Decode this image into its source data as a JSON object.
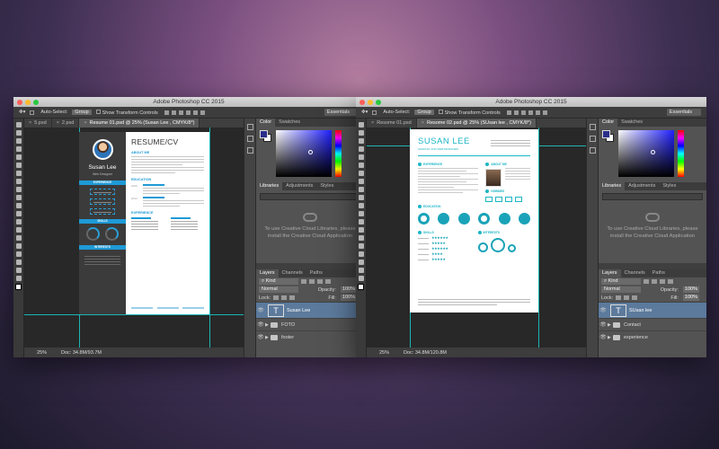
{
  "windows": [
    {
      "title": "Adobe Photoshop CC 2015",
      "options": {
        "auto_select_label": "Auto-Select:",
        "auto_select_value": "Group",
        "transform_label": "Show Transform Controls",
        "workspace": "Essentials"
      },
      "tabs": [
        {
          "label": "5.psd"
        },
        {
          "label": "2.psd"
        },
        {
          "label": "Resume 01.psd @ 25% (Susan Lee , CMYK/8*)"
        }
      ],
      "status": {
        "zoom": "25%",
        "doc": "Doc: 34.8M/93.7M"
      },
      "color_tabs": [
        "Color",
        "Swatches"
      ],
      "lib_tabs": [
        "Libraries",
        "Adjustments",
        "Styles"
      ],
      "libraries_message": "To use Creative Cloud Libraries, please install the Creative Cloud Application",
      "layer_tabs": [
        "Layers",
        "Channels",
        "Paths"
      ],
      "layer_controls": {
        "kind": "Kind",
        "blend": "Normal",
        "opacity_label": "Opacity:",
        "opacity": "100%",
        "lock_label": "Lock:",
        "fill_label": "Fill:",
        "fill": "100%"
      },
      "layers": [
        {
          "name": "Susan Lee",
          "type": "text",
          "selected": true
        },
        {
          "name": "FOTO",
          "type": "folder",
          "selected": false
        },
        {
          "name": "footer",
          "type": "folder",
          "selected": false
        }
      ],
      "resume": {
        "name": "Susan Lee",
        "role": "Web Designer",
        "title": "RESUME/CV",
        "about": "ABOUT ME",
        "education": "EDUCATION",
        "experience": "EXPERIENCE",
        "side_sections": [
          "EXPERIENCE",
          "SKILLS",
          "INTERESTS"
        ],
        "years": [
          "2009",
          "2013"
        ]
      }
    },
    {
      "title": "Adobe Photoshop CC 2015",
      "options": {
        "auto_select_label": "Auto-Select:",
        "auto_select_value": "Group",
        "transform_label": "Show Transform Controls",
        "workspace": "Essentials"
      },
      "tabs": [
        {
          "label": "Resome 01.psd"
        },
        {
          "label": "Resome 02.psd @ 25% (SUsan lee , CMYK/8*)"
        }
      ],
      "status": {
        "zoom": "25%",
        "doc": "Doc: 34.8M/120.8M"
      },
      "color_tabs": [
        "Color",
        "Swatches"
      ],
      "lib_tabs": [
        "Libraries",
        "Adjustments",
        "Styles"
      ],
      "libraries_message": "To use Creative Cloud Libraries, please install the Creative Cloud Application",
      "layer_tabs": [
        "Layers",
        "Channels",
        "Paths"
      ],
      "layer_controls": {
        "kind": "Kind",
        "blend": "Normal",
        "opacity_label": "Opacity:",
        "opacity": "100%",
        "lock_label": "Lock:",
        "fill_label": "Fill:",
        "fill": "100%"
      },
      "layers": [
        {
          "name": "SUsan lee",
          "type": "text",
          "selected": true
        },
        {
          "name": "Contact",
          "type": "folder",
          "selected": false
        },
        {
          "name": "experience",
          "type": "folder",
          "selected": false
        }
      ],
      "resume": {
        "name": "SUSAN LEE",
        "subtitle": "GRAPHIC AND WEB DESIGNER",
        "sections": [
          "EXPERIENCE",
          "ABOUT ME",
          "HOBBIES",
          "EDUCATION",
          "SKILLS",
          "INTERESTS"
        ]
      }
    }
  ],
  "colors": {
    "accent_blue": "#1e9ad6",
    "accent_teal": "#1cb5c5",
    "layer_selected": "#5c7a9c"
  }
}
